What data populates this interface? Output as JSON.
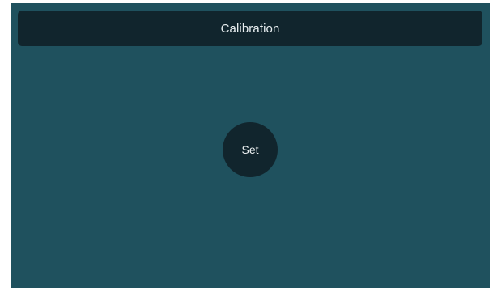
{
  "header": {
    "title": "Calibration"
  },
  "main": {
    "set_button_label": "Set"
  },
  "colors": {
    "background": "#1f515e",
    "header_background": "#11252d",
    "button_background": "#11252d",
    "text": "#eef2f3"
  }
}
